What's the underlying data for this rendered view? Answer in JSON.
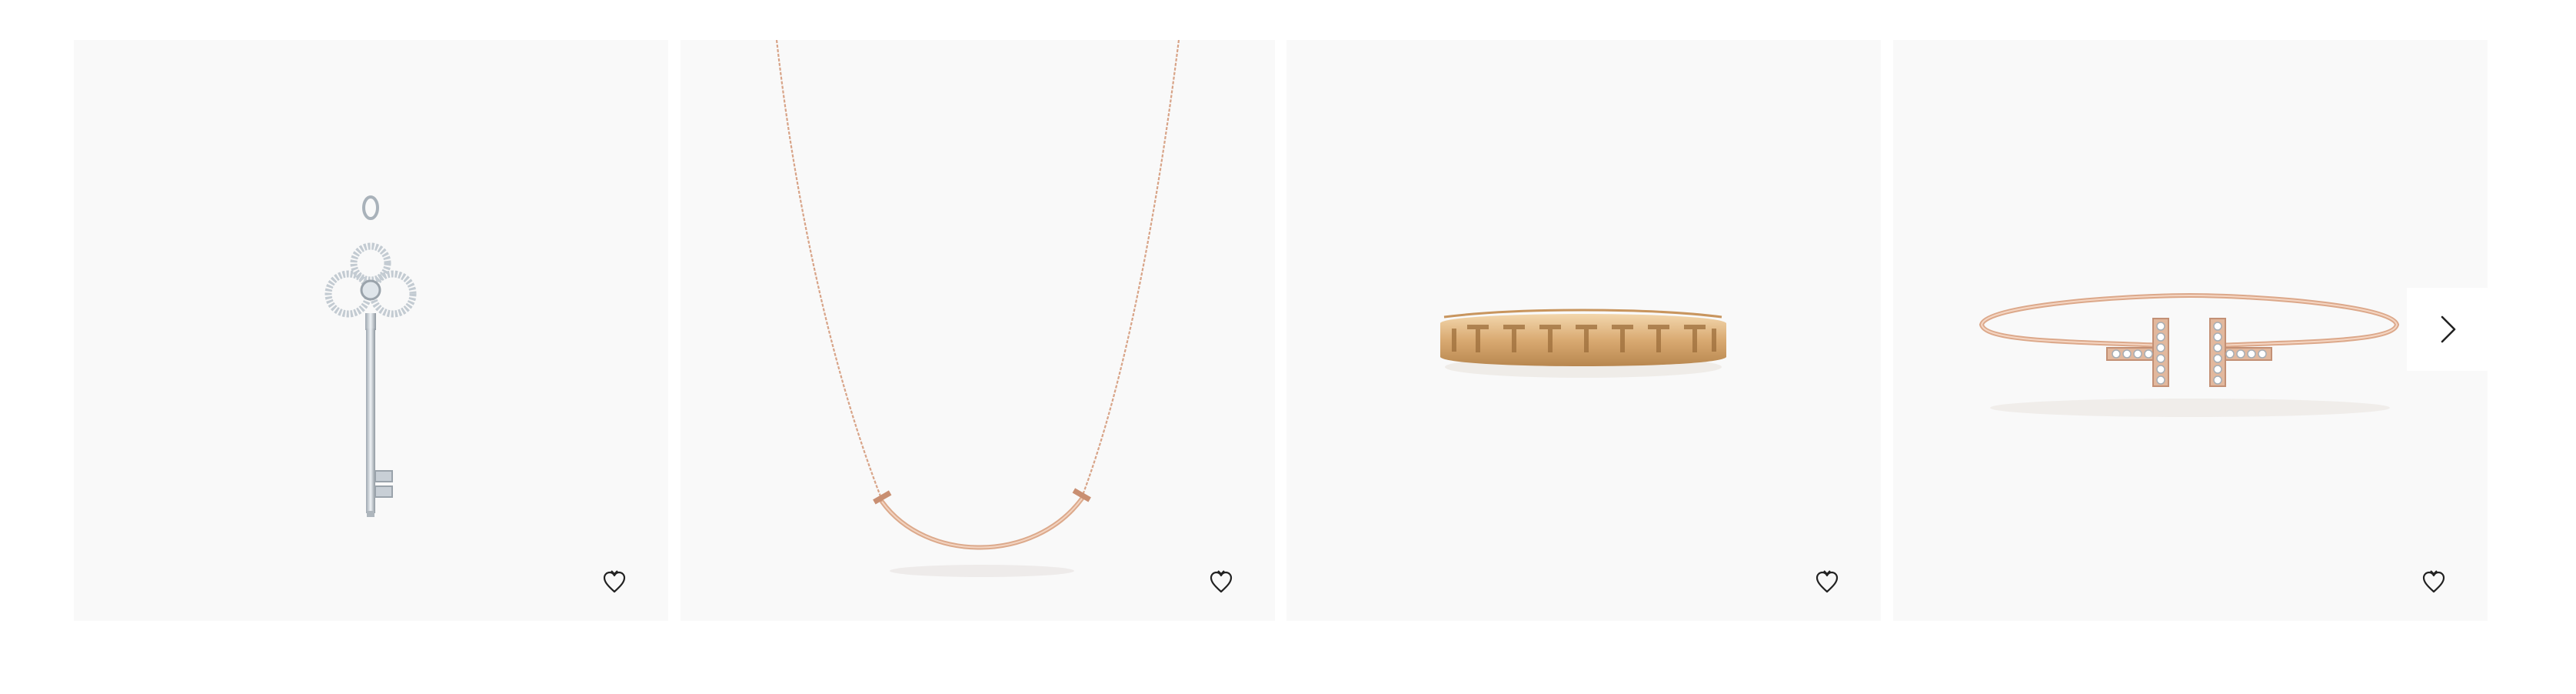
{
  "carousel": {
    "products": [
      {
        "name": "key-pendant",
        "icon": "wishlist-heart-icon"
      },
      {
        "name": "smile-necklace",
        "icon": "wishlist-heart-icon"
      },
      {
        "name": "t-ring",
        "icon": "wishlist-heart-icon"
      },
      {
        "name": "t-wire-bracelet",
        "icon": "wishlist-heart-icon"
      }
    ],
    "next_icon": "chevron-right-icon"
  },
  "colors": {
    "card_background": "#f9f9f9",
    "page_background": "#ffffff",
    "silver": "#c9d0d6",
    "rose_gold": "#e0a98a",
    "gold": "#e5c08c",
    "icon": "#222222"
  }
}
